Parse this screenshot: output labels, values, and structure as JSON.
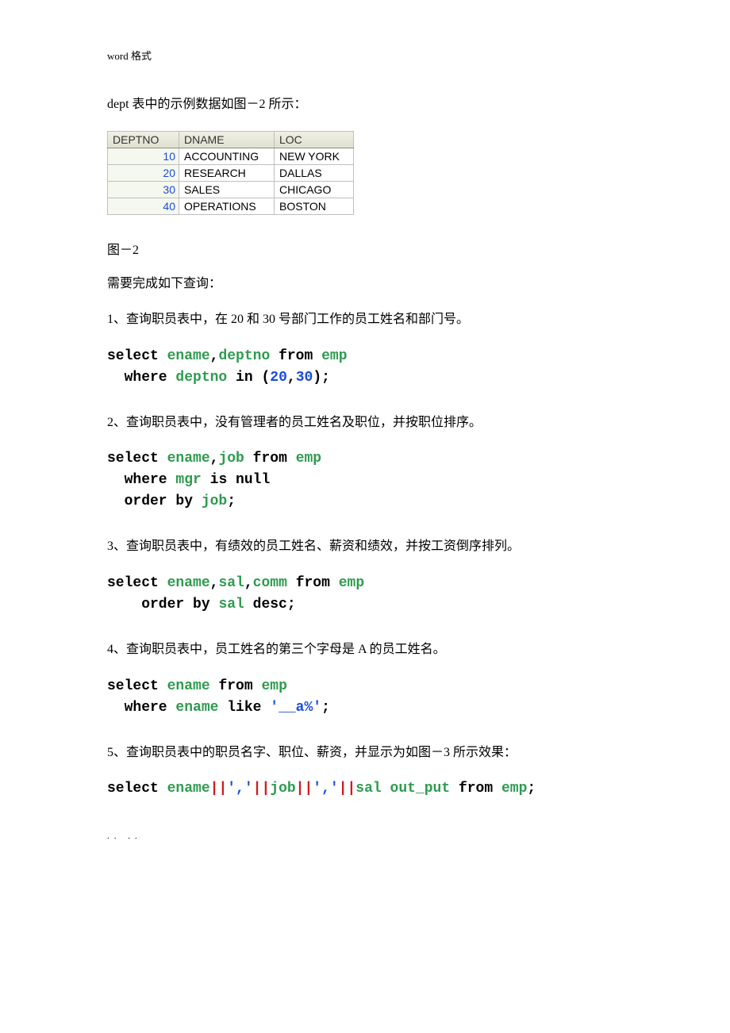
{
  "header_note": "word 格式",
  "intro_line": "dept 表中的示例数据如图－2 所示：",
  "table": {
    "headers": [
      "DEPTNO",
      "DNAME",
      "LOC"
    ],
    "rows": [
      {
        "deptno": "10",
        "dname": "ACCOUNTING",
        "loc": "NEW YORK"
      },
      {
        "deptno": "20",
        "dname": "RESEARCH",
        "loc": "DALLAS"
      },
      {
        "deptno": "30",
        "dname": "SALES",
        "loc": "CHICAGO"
      },
      {
        "deptno": "40",
        "dname": "OPERATIONS",
        "loc": "BOSTON"
      }
    ]
  },
  "fig_caption": "图－2",
  "subheading": "需要完成如下查询：",
  "q1": "1、查询职员表中，在 20 和 30 号部门工作的员工姓名和部门号。",
  "code1": {
    "select": "select",
    "c1": "ename",
    "comma1": ",",
    "c2": "deptno",
    "from": "from",
    "t": "emp",
    "where": "where",
    "c3": "deptno",
    "in": "in",
    "lp": "(",
    "v1": "20",
    "comma2": ",",
    "v2": "30",
    "rp": ")",
    "semi": ";"
  },
  "q2": "2、查询职员表中，没有管理者的员工姓名及职位，并按职位排序。",
  "code2": {
    "select": "select",
    "c1": "ename",
    "comma1": ",",
    "c2": "job",
    "from": "from",
    "t": "emp",
    "where": "where",
    "c3": "mgr",
    "isnull": "is null",
    "orderby": "order by",
    "c4": "job",
    "semi": ";"
  },
  "q3": "3、查询职员表中，有绩效的员工姓名、薪资和绩效，并按工资倒序排列。",
  "code3": {
    "select": "select",
    "c1": "ename",
    "comma1": ",",
    "c2": "sal",
    "comma2": ",",
    "c3": "comm",
    "from": "from",
    "t": "emp",
    "orderby": "order by",
    "c4": "sal",
    "desc": "desc",
    "semi": ";"
  },
  "q4": "4、查询职员表中，员工姓名的第三个字母是 A 的员工姓名。",
  "code4": {
    "select": "select",
    "c1": "ename",
    "from": "from",
    "t": "emp",
    "where": "where",
    "c2": "ename",
    "like": "like",
    "pat": "'__a%'",
    "semi": ";"
  },
  "q5": "5、查询职员表中的职员名字、职位、薪资，并显示为如图－3 所示效果：",
  "code5": {
    "select": "select",
    "c1": "ename",
    "concat1": "||",
    "s1": "','",
    "concat2": "||",
    "c2": "job",
    "concat3": "||",
    "s2": "','",
    "concat4": "||",
    "c3": "sal",
    "alias": "out_put",
    "from": "from",
    "t": "emp",
    "semi": ";"
  },
  "footer": ".. .."
}
